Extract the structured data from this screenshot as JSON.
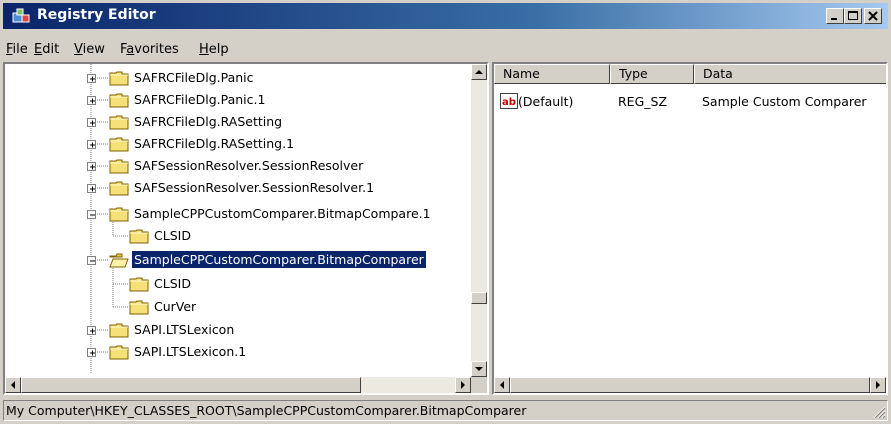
{
  "window": {
    "title": "Registry Editor"
  },
  "menu": [
    {
      "label": "File",
      "accel": "F"
    },
    {
      "label": "Edit",
      "accel": "E"
    },
    {
      "label": "View",
      "accel": "V"
    },
    {
      "label": "Favorites",
      "accel": "a"
    },
    {
      "label": "Help",
      "accel": "H"
    }
  ],
  "tree": {
    "nodes": [
      {
        "label": "SAFRCFileDlg.Panic",
        "expander": "plus",
        "level": 0
      },
      {
        "label": "SAFRCFileDlg.Panic.1",
        "expander": "plus",
        "level": 0
      },
      {
        "label": "SAFRCFileDlg.RASetting",
        "expander": "plus",
        "level": 0
      },
      {
        "label": "SAFRCFileDlg.RASetting.1",
        "expander": "plus",
        "level": 0
      },
      {
        "label": "SAFSessionResolver.SessionResolver",
        "expander": "plus",
        "level": 0
      },
      {
        "label": "SAFSessionResolver.SessionResolver.1",
        "expander": "plus",
        "level": 0
      },
      {
        "label": "SampleCPPCustomComparer.BitmapCompare.1",
        "expander": "minus",
        "level": 0
      },
      {
        "label": "CLSID",
        "expander": "none",
        "level": 1
      },
      {
        "label": "SampleCPPCustomComparer.BitmapComparer",
        "expander": "minus",
        "level": 0,
        "selected": true,
        "open": true
      },
      {
        "label": "CLSID",
        "expander": "none",
        "level": 1
      },
      {
        "label": "CurVer",
        "expander": "none",
        "level": 1
      },
      {
        "label": "SAPI.LTSLexicon",
        "expander": "plus",
        "level": 0
      },
      {
        "label": "SAPI.LTSLexicon.1",
        "expander": "plus",
        "level": 0
      }
    ]
  },
  "list": {
    "columns": [
      "Name",
      "Type",
      "Data"
    ],
    "rows": [
      {
        "icon": "string-value-icon",
        "name": "(Default)",
        "type": "REG_SZ",
        "data": "Sample Custom Comparer"
      }
    ]
  },
  "status": {
    "path": "My Computer\\HKEY_CLASSES_ROOT\\SampleCPPCustomComparer.BitmapComparer"
  },
  "colors": {
    "titlebar_start": "#0a246a",
    "titlebar_end": "#a6caf0",
    "selection": "#0a246a",
    "folder": "#f5e07a"
  }
}
